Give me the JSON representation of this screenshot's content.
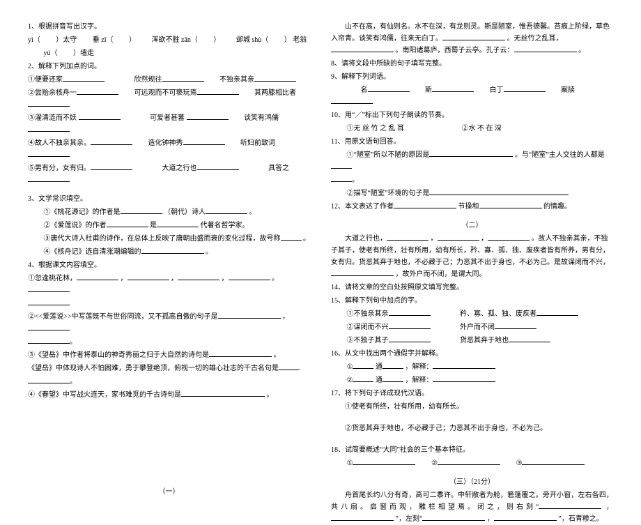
{
  "left": {
    "q1_title": "1、根据拼音写出汉字。",
    "q1_l1a": "yì（",
    "q1_l1b": "）太守",
    "q1_l1c": "垂 zī（",
    "q1_l1d": "）",
    "q1_l1e": "浑欲不胜 zān（",
    "q1_l1f": "）",
    "q1_l1g": "邺城 shù（",
    "q1_l1h": "）",
    "q1_l1i": "老翁",
    "q1_l2a": "yú（",
    "q1_l2b": "）墙走",
    "q2_title": "2、解释下列加点的词。",
    "q2_1a": "①便要还家",
    "q2_1b": "欣然规往",
    "q2_1c": "不独亲其亲",
    "q2_2a": "②尝贻余核舟一",
    "q2_2b": "可远观而不可亵玩焉",
    "q2_2c": "其两膝相比者",
    "q2_3a": "③濯清涟而不妖",
    "q2_3b": "可爱者甚蕃",
    "q2_3c": "谈笑有鸿儒",
    "q2_4a": "④故人不独亲其亲。",
    "q2_4b": "造化钟神秀",
    "q2_4c": "听妇前致词",
    "q2_5a": "⑤男有分，女有归。",
    "q2_5b": "大道之行也",
    "q2_5c": "具答之",
    "q3_title": "3、文学常识填空。",
    "q3_1a": "①《桃花源记》的作者是",
    "q3_1b": "（朝代）诗人",
    "q3_1c": "。",
    "q3_2a": "②《爱莲说》的作者",
    "q3_2b": "是",
    "q3_2c": "代著名哲学家。",
    "q3_3a": "③唐代大诗人杜甫的诗作，在总体上反映了唐朝由盛而衰的变化过程，故号称",
    "q3_3b": "。",
    "q3_4a": "④《核舟记》选自清涨潮编辑的",
    "q3_4b": "。",
    "q4_title": "4、根据课文内容填空。",
    "q4_1a": "①忽逢桃花林，",
    "q4_1b": "，",
    "q4_1c": "，",
    "q4_1d": "，",
    "q4_1e": "。",
    "q4_2a": "②<<爱莲说>>中写莲既不与世俗同流，又不孤高自傲的句子是",
    "q4_2b": "，",
    "q4_2c": "。",
    "q4_3a": "③《望岳》中作者将泰山的神奇秀丽之归于大自然的诗句是",
    "q4_3b": "。",
    "q4_3c": "《望岳》中体现诗人不怕困难，勇于攀登绝顶，俯视一切的雄心壮志的千古名句是",
    "q4_3d": "。",
    "q4_4a": "④《春望》中写战火连天，家书难觅的千古诗句是",
    "q4_4b": "。",
    "sec1": "（一）"
  },
  "right": {
    "passage1_l1": "山不在高，有仙则名。水不在深，有龙则灵。斯是陋室，惟吾德馨。苔痕上阶绿，草色入帘青。谈笑有鸿儒，往来无白丁。",
    "passage1_l2": "。无丝竹之乱耳，",
    "passage1_l3": "。南阳诸葛庐，西蜀子云亭。孔子云：",
    "passage1_l4": "。",
    "q8": "8、请将文段中所缺的句子填写完整。",
    "q9": "9、解释下列词语。",
    "q9a": "名",
    "q9b": "斯",
    "q9c": "白丁",
    "q9d": "案牍",
    "q10": "10、用“／”标出下列句子朗读的节奏。",
    "q10a": "①无 丝 竹 之 乱 耳",
    "q10b": "②水 不 在 深",
    "q11": "11、用原文语句回答。",
    "q11_1a": "①“陋室”所以不陋的原因是",
    "q11_1b": "。与“陋室”主人交往的人都是",
    "q11_1c": "。",
    "q11_2a": "②描写“陋室”环境的句子是",
    "q12a": "12、本文表达了作者",
    "q12b": "节操和",
    "q12c": "的情趣。",
    "sec2": "（二）",
    "passage2_l1a": "大道之行也，",
    "passage2_l1b": "，",
    "passage2_l1c": "，",
    "passage2_l1d": "。故人不独亲其亲，不独子其子，使老有所终，壮有所用，幼有所长，矜、寡、孤、独、废疾者皆有所养，男有分，女有归。货恶其弃于地也，不必藏于己；力恶其不出于身也，不必为己。是故谋闭而不兴，",
    "passage2_l1e": "，故外户而不闭，是谓大同。",
    "q14": "14、请将文章的空白处按照原文填写完整。",
    "q15": "15、解释下列句中加点的字。",
    "q15_1a": "①不独亲其亲",
    "q15_1b": "矜、寡、孤、独、废疾者",
    "q15_2a": "②谋闭而不兴",
    "q15_2b": "外户而不闭",
    "q15_3a": "③不独子其子",
    "q15_3b": "货恶其弃于地也",
    "q16a": "16、从文中找出两个通假字并解释。",
    "q16_1a": "①",
    "q16_1b": "通",
    "q16_1c": "，解释：",
    "q16_2a": "②",
    "q16_2b": "通",
    "q16_2c": "，解释：",
    "q17": "17、将下列句子译成现代汉语。",
    "q17_1": "①使老有所终，壮有所用，幼有所长。",
    "q17_2": "②货恶其弃于地也，不必藏于己；力恶其不出于身也，不必为己。",
    "q18": "18、试简要概述“大同”社会的三个基本特征。",
    "q18a": "①",
    "q18b": "②",
    "q18c": "③",
    "sec3": "（三）（21分）",
    "passage3_l1": "舟首尾长约八分有奇，高可二黍许。中轩敞者为舱，箬篷覆之。旁开小窗，左右各四，共八扇。启窗而观，雕栏相望焉。闭之，则右刻“",
    "passage3_l2": "，",
    "passage3_l3": "”，左刻“",
    "passage3_l4": "，",
    "passage3_l5": "”，石青糁之。"
  }
}
